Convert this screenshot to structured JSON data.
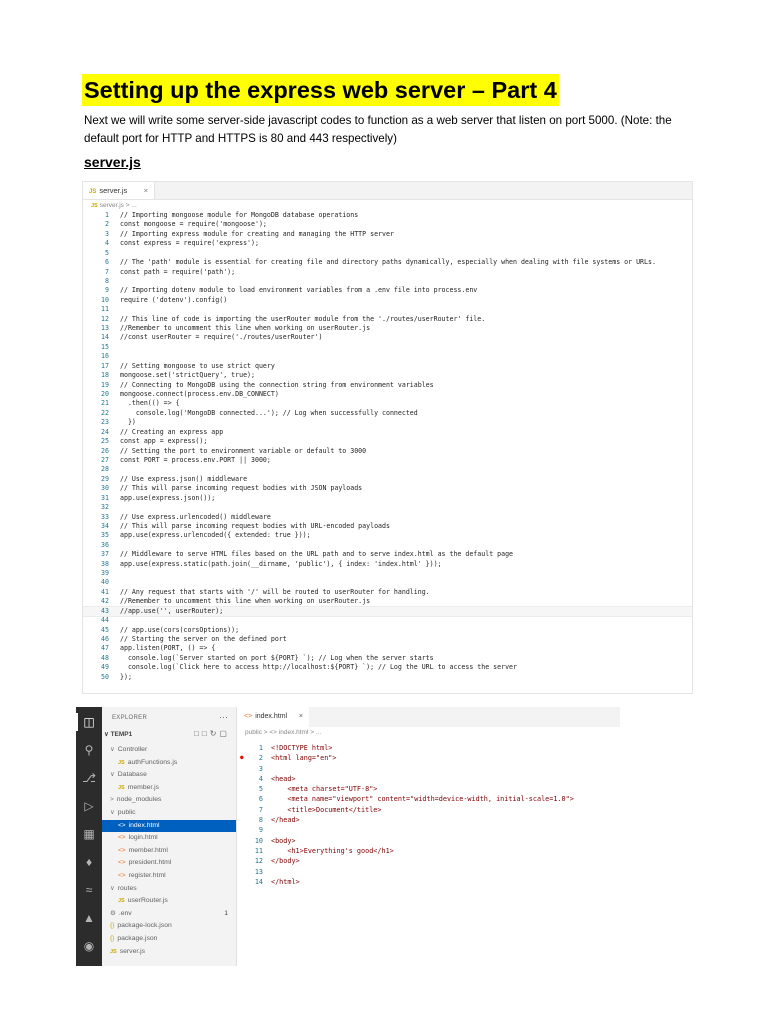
{
  "title": "Setting up the express web server – Part 4",
  "intro": "Next we will write some server-side javascript codes to function as a web server that listen on port 5000. (Note: the default port for HTTP and HTTPS is 80 and 443 respectively)",
  "subheading": "server.js",
  "editor1": {
    "tab_label": "server.js",
    "tab_close": "×",
    "breadcrumb": "server.js > ...",
    "lang_badge": "JS",
    "lines": [
      "// Importing mongoose module for MongoDB database operations",
      "const mongoose = require('mongoose');",
      "// Importing express module for creating and managing the HTTP server",
      "const express = require('express');",
      "",
      "// The 'path' module is essential for creating file and directory paths dynamically, especially when dealing with file systems or URLs.",
      "const path = require('path');",
      "",
      "// Importing dotenv module to load environment variables from a .env file into process.env",
      "require ('dotenv').config()",
      "",
      "// This line of code is importing the userRouter module from the './routes/userRouter' file.",
      "//Remember to uncomment this line when working on userRouter.js",
      "//const userRouter = require('./routes/userRouter')",
      "",
      "",
      "// Setting mongoose to use strict query",
      "mongoose.set('strictQuery', true);",
      "// Connecting to MongoDB using the connection string from environment variables",
      "mongoose.connect(process.env.DB_CONNECT)",
      "  .then(() => {",
      "    console.log('MongoDB connected...'); // Log when successfully connected",
      "  })",
      "// Creating an express app",
      "const app = express();",
      "// Setting the port to environment variable or default to 3000",
      "const PORT = process.env.PORT || 3000;",
      "",
      "// Use express.json() middleware",
      "// This will parse incoming request bodies with JSON payloads",
      "app.use(express.json());",
      "",
      "// Use express.urlencoded() middleware",
      "// This will parse incoming request bodies with URL-encoded payloads",
      "app.use(express.urlencoded({ extended: true }));",
      "",
      "// Middleware to serve HTML files based on the URL path and to serve index.html as the default page",
      "app.use(express.static(path.join(__dirname, 'public'), { index: 'index.html' }));",
      "",
      "",
      "// Any request that starts with '/' will be routed to userRouter for handling.",
      "//Remember to uncomment this line when working on userRouter.js",
      "//app.use('', userRouter);",
      "",
      "// app.use(cors(corsOptions));",
      "// Starting the server on the defined port",
      "app.listen(PORT, () => {",
      "  console.log(`Server started on port ${PORT} `); // Log when the server starts",
      "  console.log(`Click here to access http://localhost:${PORT} `); // Log the URL to access the server",
      "});"
    ]
  },
  "editor2": {
    "explorer_label": "EXPLORER",
    "explorer_more": "···",
    "root_label": "TEMP1",
    "tab_label": "index.html",
    "tab_close": "×",
    "breadcrumb": "public > <> index.html > ...",
    "tree": [
      {
        "label": "Controller",
        "kind": "folder",
        "indent": 1
      },
      {
        "label": "authFunctions.js",
        "kind": "js",
        "indent": 2
      },
      {
        "label": "Database",
        "kind": "folder",
        "indent": 1
      },
      {
        "label": "member.js",
        "kind": "js",
        "indent": 2
      },
      {
        "label": "node_modules",
        "kind": "folder-closed",
        "indent": 1
      },
      {
        "label": "public",
        "kind": "folder",
        "indent": 1
      },
      {
        "label": "index.html",
        "kind": "html",
        "indent": 2,
        "selected": true
      },
      {
        "label": "login.html",
        "kind": "html",
        "indent": 2
      },
      {
        "label": "member.html",
        "kind": "html",
        "indent": 2
      },
      {
        "label": "president.html",
        "kind": "html",
        "indent": 2
      },
      {
        "label": "register.html",
        "kind": "html",
        "indent": 2
      },
      {
        "label": "routes",
        "kind": "folder",
        "indent": 1
      },
      {
        "label": "userRouter.js",
        "kind": "js",
        "indent": 2
      },
      {
        "label": ".env",
        "kind": "gear",
        "indent": 1,
        "badge": "1"
      },
      {
        "label": "package-lock.json",
        "kind": "json",
        "indent": 1
      },
      {
        "label": "package.json",
        "kind": "json",
        "indent": 1
      },
      {
        "label": "server.js",
        "kind": "js",
        "indent": 1
      }
    ],
    "lines": [
      "<!DOCTYPE html>",
      "<html lang=\"en\">",
      "",
      "<head>",
      "    <meta charset=\"UTF-8\">",
      "    <meta name=\"viewport\" content=\"width=device-width, initial-scale=1.0\">",
      "    <title>Document</title>",
      "</head>",
      "",
      "<body>",
      "    <h1>Everything's good</h1>",
      "</body>",
      "",
      "</html>"
    ],
    "colors": {
      "activity_bar": "#2c2c2c",
      "selection": "#0060c0",
      "sidebar": "#f3f3f3"
    }
  },
  "colors": {
    "title_highlight": "#ffff00",
    "comment": "#008000",
    "line_number": "#237893"
  }
}
